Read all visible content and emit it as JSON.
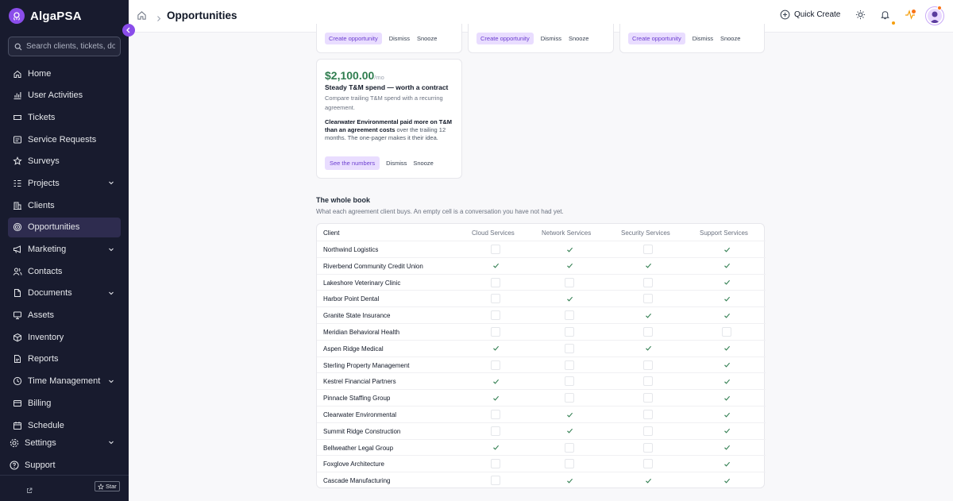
{
  "app": {
    "name": "AlgaPSA"
  },
  "search": {
    "placeholder": "Search clients, tickets, doc"
  },
  "nav": [
    {
      "label": "Home",
      "icon": "home-icon",
      "chevron": false,
      "active": false
    },
    {
      "label": "User Activities",
      "icon": "chart-icon",
      "chevron": false,
      "active": false
    },
    {
      "label": "Tickets",
      "icon": "ticket-icon",
      "chevron": false,
      "active": false
    },
    {
      "label": "Service Requests",
      "icon": "service-icon",
      "chevron": false,
      "active": false
    },
    {
      "label": "Surveys",
      "icon": "star-icon",
      "chevron": false,
      "active": false
    },
    {
      "label": "Projects",
      "icon": "projects-icon",
      "chevron": true,
      "active": false
    },
    {
      "label": "Clients",
      "icon": "building-icon",
      "chevron": false,
      "active": false
    },
    {
      "label": "Opportunities",
      "icon": "target-icon",
      "chevron": false,
      "active": true
    },
    {
      "label": "Marketing",
      "icon": "megaphone-icon",
      "chevron": true,
      "active": false
    },
    {
      "label": "Contacts",
      "icon": "users-icon",
      "chevron": false,
      "active": false
    },
    {
      "label": "Documents",
      "icon": "document-icon",
      "chevron": true,
      "active": false
    },
    {
      "label": "Assets",
      "icon": "monitor-icon",
      "chevron": false,
      "active": false
    },
    {
      "label": "Inventory",
      "icon": "box-icon",
      "chevron": false,
      "active": false
    },
    {
      "label": "Reports",
      "icon": "report-icon",
      "chevron": false,
      "active": false
    },
    {
      "label": "Time Management",
      "icon": "clock-icon",
      "chevron": true,
      "active": false
    },
    {
      "label": "Billing",
      "icon": "billing-icon",
      "chevron": false,
      "active": false
    },
    {
      "label": "Schedule",
      "icon": "calendar-icon",
      "chevron": false,
      "active": false
    }
  ],
  "settings_label": "Settings",
  "support_label": "Support",
  "star_label": "Star",
  "header": {
    "title": "Opportunities",
    "quick_create": "Quick Create"
  },
  "top_cards": {
    "create_label": "Create opportunity",
    "dismiss_label": "Dismiss",
    "snooze_label": "Snooze"
  },
  "opportunity_card": {
    "amount": "$2,100.00",
    "unit": "/mo",
    "title": "Steady T&M spend — worth a contract",
    "description": "Compare trailing T&M spend with a recurring agreement.",
    "body_bold": "Clearwater Environmental paid more on T&M than an agreement costs",
    "body_rest": " over the trailing 12 months. The one-pager makes it their idea.",
    "primary_action": "See the numbers",
    "dismiss": "Dismiss",
    "snooze": "Snooze"
  },
  "book": {
    "title": "The whole book",
    "subtitle": "What each agreement client buys. An empty cell is a conversation you have not had yet.",
    "columns": [
      "Client",
      "Cloud Services",
      "Network Services",
      "Security Services",
      "Support Services"
    ],
    "rows": [
      {
        "client": "Northwind Logistics",
        "cells": [
          false,
          true,
          false,
          true
        ]
      },
      {
        "client": "Riverbend Community Credit Union",
        "cells": [
          true,
          true,
          true,
          true
        ]
      },
      {
        "client": "Lakeshore Veterinary Clinic",
        "cells": [
          false,
          false,
          false,
          true
        ]
      },
      {
        "client": "Harbor Point Dental",
        "cells": [
          false,
          true,
          false,
          true
        ]
      },
      {
        "client": "Granite State Insurance",
        "cells": [
          false,
          false,
          true,
          true
        ]
      },
      {
        "client": "Meridian Behavioral Health",
        "cells": [
          false,
          false,
          false,
          false
        ]
      },
      {
        "client": "Aspen Ridge Medical",
        "cells": [
          true,
          false,
          true,
          true
        ]
      },
      {
        "client": "Sterling Property Management",
        "cells": [
          false,
          false,
          false,
          true
        ]
      },
      {
        "client": "Kestrel Financial Partners",
        "cells": [
          true,
          false,
          false,
          true
        ]
      },
      {
        "client": "Pinnacle Staffing Group",
        "cells": [
          true,
          false,
          false,
          true
        ]
      },
      {
        "client": "Clearwater Environmental",
        "cells": [
          false,
          true,
          false,
          true
        ]
      },
      {
        "client": "Summit Ridge Construction",
        "cells": [
          false,
          true,
          false,
          true
        ]
      },
      {
        "client": "Bellweather Legal Group",
        "cells": [
          true,
          false,
          false,
          true
        ]
      },
      {
        "client": "Foxglove Architecture",
        "cells": [
          false,
          false,
          false,
          true
        ]
      },
      {
        "client": "Cascade Manufacturing",
        "cells": [
          false,
          true,
          true,
          true
        ]
      }
    ]
  },
  "colors": {
    "accent": "#8a4dea",
    "sidebar_bg": "#181b2e",
    "money_green": "#2f7d4f",
    "check_green": "#2f7d4f"
  }
}
